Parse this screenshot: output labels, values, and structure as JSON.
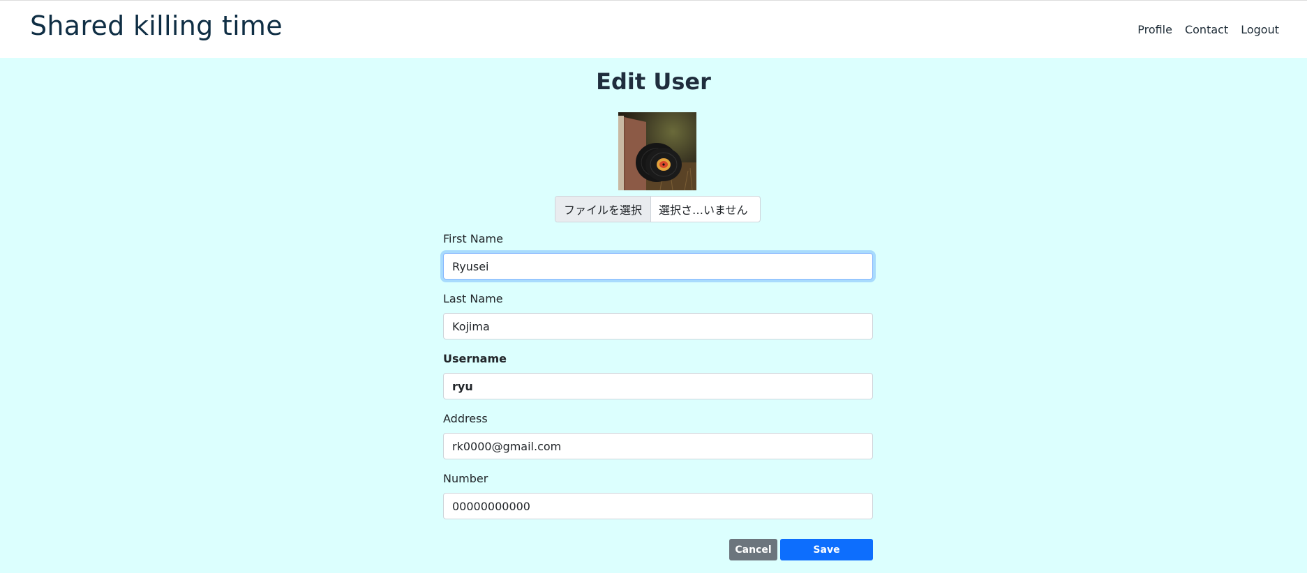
{
  "nav": {
    "brand": "Shared killing time",
    "links": [
      "Profile",
      "Contact",
      "Logout"
    ]
  },
  "page": {
    "title": "Edit User"
  },
  "avatar": {
    "alt": "profile photo of vinyl records"
  },
  "file_input": {
    "button_label": "ファイルを選択",
    "status": "選択さ…いません"
  },
  "fields": {
    "first_name": {
      "label": "First Name",
      "value": "Ryusei"
    },
    "last_name": {
      "label": "Last Name",
      "value": "Kojima"
    },
    "username": {
      "label": "Username",
      "value": "ryu"
    },
    "address": {
      "label": "Address",
      "value": "rk0000@gmail.com"
    },
    "number": {
      "label": "Number",
      "value": "00000000000"
    }
  },
  "actions": {
    "cancel_label": "Cancel",
    "save_label": "Save"
  },
  "colors": {
    "main_bg": "#dcfffe",
    "cancel": "#6c757d",
    "save": "#0d6efd",
    "brand": "#0f2e44"
  }
}
